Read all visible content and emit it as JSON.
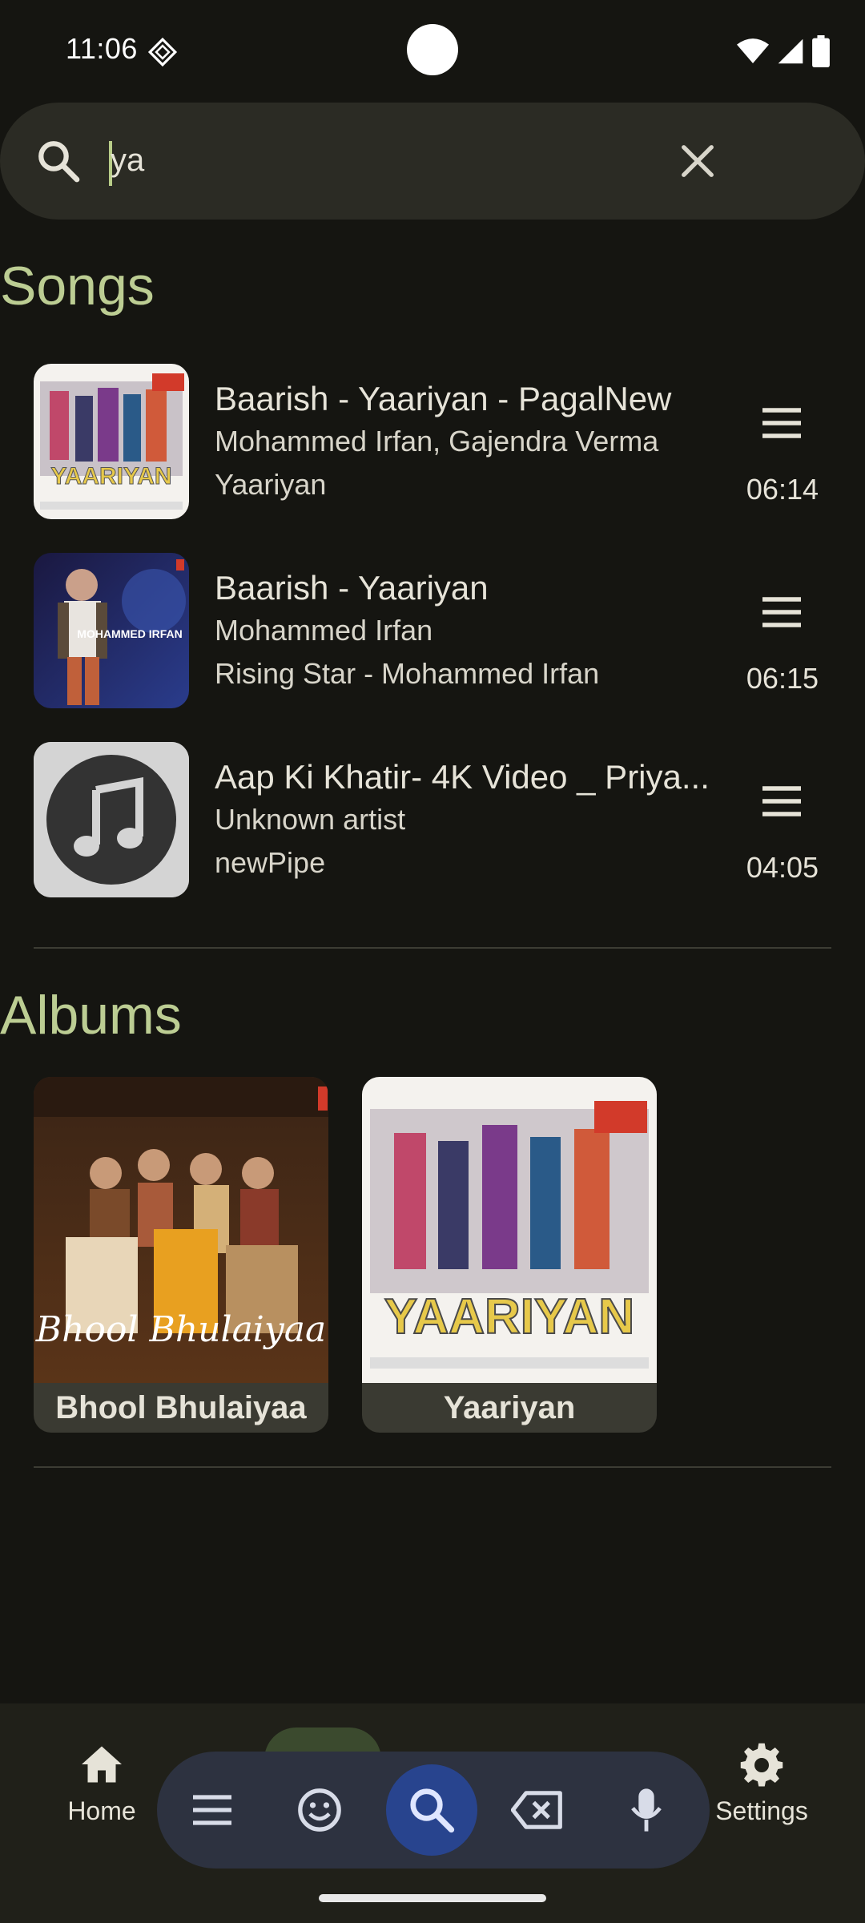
{
  "status_bar": {
    "time": "11:06",
    "icons": [
      "sim-diamond-icon",
      "wifi-icon",
      "signal-icon",
      "battery-icon"
    ]
  },
  "search": {
    "query": "ya",
    "icons": [
      "search-icon",
      "close-icon"
    ]
  },
  "songs_section": {
    "title": "Songs",
    "items": [
      {
        "title": "Baarish - Yaariyan - PagalNew",
        "artist": "Mohammed Irfan, Gajendra Verma",
        "album": "Yaariyan",
        "duration": "06:14",
        "art": "yaariyan-cover"
      },
      {
        "title": "Baarish - Yaariyan",
        "artist": "Mohammed Irfan",
        "album": "Rising Star - Mohammed Irfan",
        "duration": "06:15",
        "art": "rising-star-cover"
      },
      {
        "title": "Aap Ki Khatir- 4K Video _ Priya...",
        "artist": "Unknown artist",
        "album": "newPipe",
        "duration": "04:05",
        "art": "music-note-icon"
      }
    ]
  },
  "albums_section": {
    "title": "Albums",
    "items": [
      {
        "name": "Bhool Bhulaiyaa"
      },
      {
        "name": "Yaariyan"
      }
    ]
  },
  "bottom_nav": {
    "items": [
      {
        "label": "Home",
        "icon": "home-icon"
      },
      {
        "label": "Settings",
        "icon": "gear-icon"
      }
    ]
  },
  "keyboard_toolbar": {
    "buttons": [
      "menu-icon",
      "emoji-icon",
      "search-icon",
      "backspace-icon",
      "mic-icon"
    ],
    "active": "search-icon"
  },
  "colors": {
    "background": "#151511",
    "accent": "#bccd93",
    "surface": "#2b2b24",
    "toolbar": "#2d3240",
    "toolbar_active": "#28448e"
  }
}
